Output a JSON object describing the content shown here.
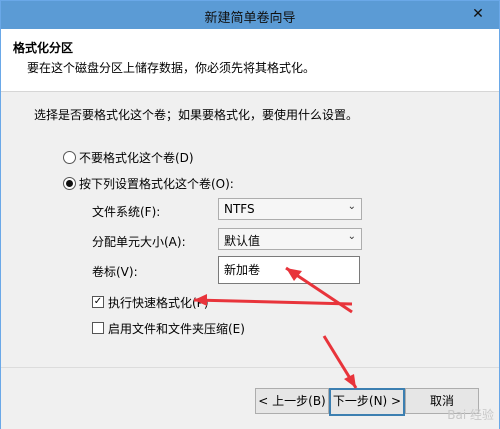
{
  "window": {
    "title": "新建简单卷向导",
    "close_glyph": "✕"
  },
  "header": {
    "title": "格式化分区",
    "subtitle": "要在这个磁盘分区上储存数据，你必须先将其格式化。"
  },
  "main": {
    "prompt": "选择是否要格式化这个卷；如果要格式化，要使用什么设置。",
    "radio_no_format": {
      "label": "不要格式化这个卷(D)",
      "selected": false
    },
    "radio_format": {
      "label": "按下列设置格式化这个卷(O):",
      "selected": true
    },
    "fields": {
      "filesystem_label": "文件系统(F):",
      "filesystem_value": "NTFS",
      "unit_label": "分配单元大小(A):",
      "unit_value": "默认值",
      "volume_label": "卷标(V):",
      "volume_value": "新加卷"
    },
    "checks": {
      "quick_format_label": "执行快速格式化(P)",
      "quick_format_checked": true,
      "compression_label": "启用文件和文件夹压缩(E)",
      "compression_checked": false
    }
  },
  "footer": {
    "back_label": "< 上一步(B)",
    "next_label": "下一步(N) >",
    "cancel_label": "取消"
  },
  "annotations": {
    "arrow_color": "#e8343b"
  },
  "watermark": "Bai 经验"
}
